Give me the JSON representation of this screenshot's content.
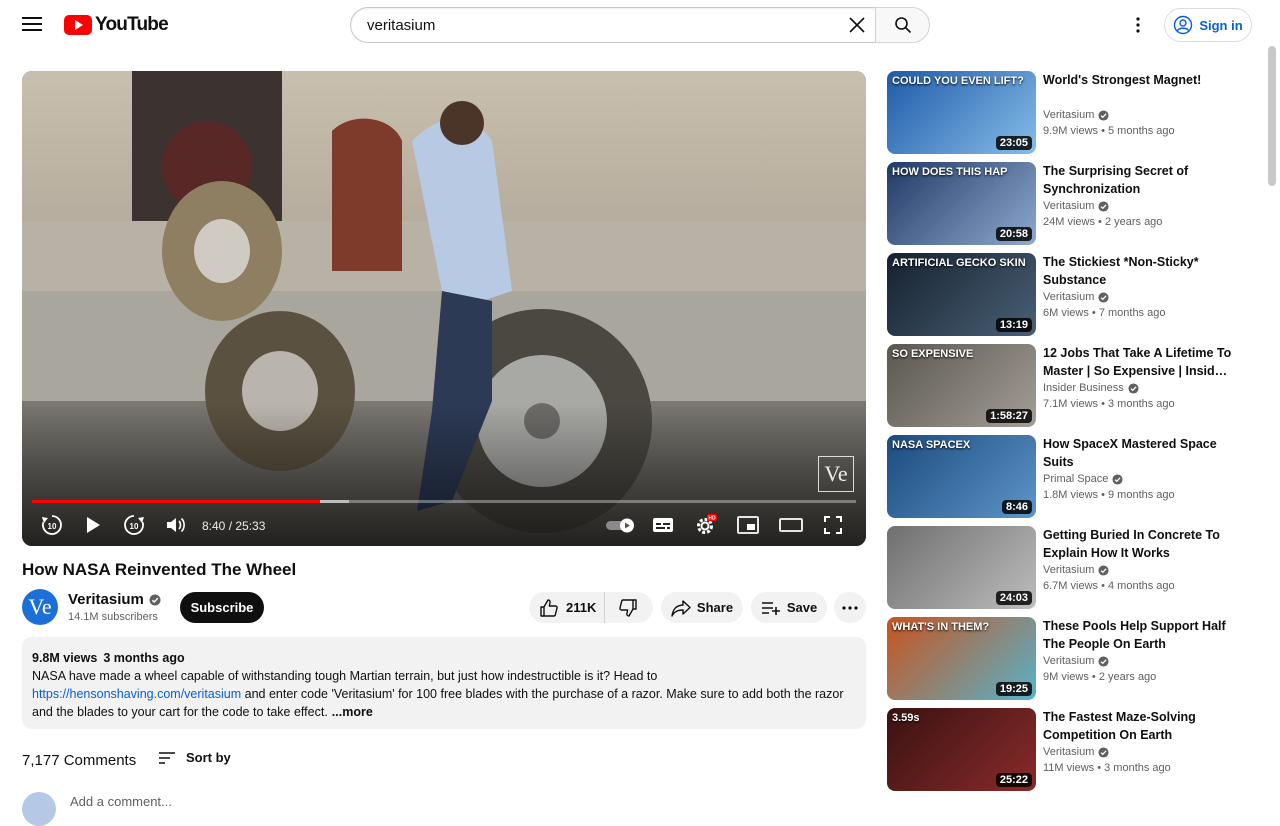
{
  "header": {
    "logo_text": "YouTube",
    "search_value": "veritasium",
    "signin_label": "Sign in"
  },
  "player": {
    "time_current": "8:40",
    "time_sep": " / ",
    "time_total": "25:33",
    "progress_played": 0.35,
    "progress_loaded": 0.385,
    "watermark": "Ve"
  },
  "video": {
    "title": "How NASA Reinvented The Wheel",
    "channel": "Veritasium",
    "channel_avatar_text": "Ve",
    "subscribers": "14.1M subscribers",
    "subscribe_label": "Subscribe",
    "likes": "211K",
    "share_label": "Share",
    "save_label": "Save"
  },
  "description": {
    "views": "9.8M views",
    "date": "3 months ago",
    "text_1": "NASA have made a wheel capable of withstanding tough Martian terrain, but just how indestructible is it? Head to",
    "link": "https://hensonshaving.com/veritasium",
    "text_2": " and enter code 'Veritasium' for 100 free blades with the purchase of a razor. Make sure to add both the razor and the blades to your cart for the code to take effect.",
    "more": "...more"
  },
  "comments": {
    "count": "7,177 Comments",
    "sort_label": "Sort by",
    "add_placeholder": "Add a comment..."
  },
  "recommendations": [
    {
      "title": "World's Strongest Magnet!",
      "channel": "Veritasium",
      "verified": true,
      "views": "9.9M views",
      "age": "5 months ago",
      "duration": "23:05",
      "thumb_text": "COULD YOU EVEN LIFT?",
      "color_a": "#1f5aa8",
      "color_b": "#86bde8"
    },
    {
      "title": "The Surprising Secret of Synchronization",
      "channel": "Veritasium",
      "verified": true,
      "views": "24M views",
      "age": "2 years ago",
      "duration": "20:58",
      "thumb_text": "HOW DOES THIS HAP",
      "color_a": "#203a66",
      "color_b": "#8fa9cf"
    },
    {
      "title": "The Stickiest *Non-Sticky* Substance",
      "channel": "Veritasium",
      "verified": true,
      "views": "6M views",
      "age": "7 months ago",
      "duration": "13:19",
      "thumb_text": "ARTIFICIAL GECKO SKIN",
      "color_a": "#15212e",
      "color_b": "#4a6076"
    },
    {
      "title": "12 Jobs That Take A Lifetime To Master | So Expensive | Insider Business",
      "channel": "Insider Business",
      "verified": true,
      "views": "7.1M views",
      "age": "3 months ago",
      "duration": "1:58:27",
      "thumb_text": "SO EXPENSIVE",
      "color_a": "#5a5650",
      "color_b": "#a39f97"
    },
    {
      "title": "How SpaceX Mastered Space Suits",
      "channel": "Primal Space",
      "verified": true,
      "views": "1.8M views",
      "age": "9 months ago",
      "duration": "8:46",
      "thumb_text": "NASA   SPACEX",
      "color_a": "#1b4a7e",
      "color_b": "#5e95c8"
    },
    {
      "title": "Getting Buried In Concrete To Explain How It Works",
      "channel": "Veritasium",
      "verified": true,
      "views": "6.7M views",
      "age": "4 months ago",
      "duration": "24:03",
      "thumb_text": "",
      "color_a": "#6f6f6f",
      "color_b": "#bdbdbd"
    },
    {
      "title": "These Pools Help Support Half The People On Earth",
      "channel": "Veritasium",
      "verified": true,
      "views": "9M views",
      "age": "2 years ago",
      "duration": "19:25",
      "thumb_text": "WHAT'S IN THEM?",
      "color_a": "#c9531e",
      "color_b": "#57b2c9"
    },
    {
      "title": "The Fastest Maze-Solving Competition On Earth",
      "channel": "Veritasium",
      "verified": true,
      "views": "11M views",
      "age": "3 months ago",
      "duration": "25:22",
      "thumb_text": "3.59s",
      "color_a": "#3a1212",
      "color_b": "#8a2a2a"
    }
  ],
  "colors": {
    "brand_red": "#ff0000",
    "link_blue": "#065fd4"
  }
}
